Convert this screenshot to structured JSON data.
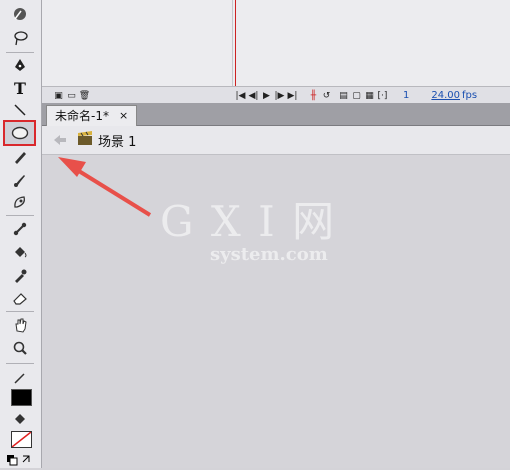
{
  "timeline": {
    "fps": "24.00",
    "fps_unit": "fps",
    "frame": "1"
  },
  "tab": {
    "label": "未命名-1*",
    "close": "×"
  },
  "scene": {
    "label": "场景 1"
  },
  "watermark": {
    "line1": "G X I 网",
    "line2": "system.com"
  },
  "colors": {
    "accent": "#d9282c",
    "arrow": "#e8504a",
    "playhead": "#cc2222"
  },
  "tools": [
    {
      "name": "subselect-tool",
      "icon": "arrow-icon"
    },
    {
      "name": "lasso-tool",
      "icon": "lasso-icon"
    },
    {
      "name": "pen-tool",
      "icon": "pen-icon"
    },
    {
      "name": "text-tool",
      "icon": "text-icon",
      "glyph": "T"
    },
    {
      "name": "line-tool",
      "icon": "line-icon"
    },
    {
      "name": "oval-tool",
      "icon": "oval-icon",
      "selected": true
    },
    {
      "name": "pencil-tool",
      "icon": "pencil-icon"
    },
    {
      "name": "brush-tool",
      "icon": "brush-icon"
    },
    {
      "name": "deco-tool",
      "icon": "deco-icon"
    },
    {
      "name": "bone-tool",
      "icon": "bone-icon"
    },
    {
      "name": "paint-bucket-tool",
      "icon": "bucket-icon"
    },
    {
      "name": "eyedropper-tool",
      "icon": "eyedropper-icon"
    },
    {
      "name": "eraser-tool",
      "icon": "eraser-icon"
    },
    {
      "name": "hand-tool",
      "icon": "hand-icon"
    },
    {
      "name": "zoom-tool",
      "icon": "zoom-icon"
    }
  ]
}
